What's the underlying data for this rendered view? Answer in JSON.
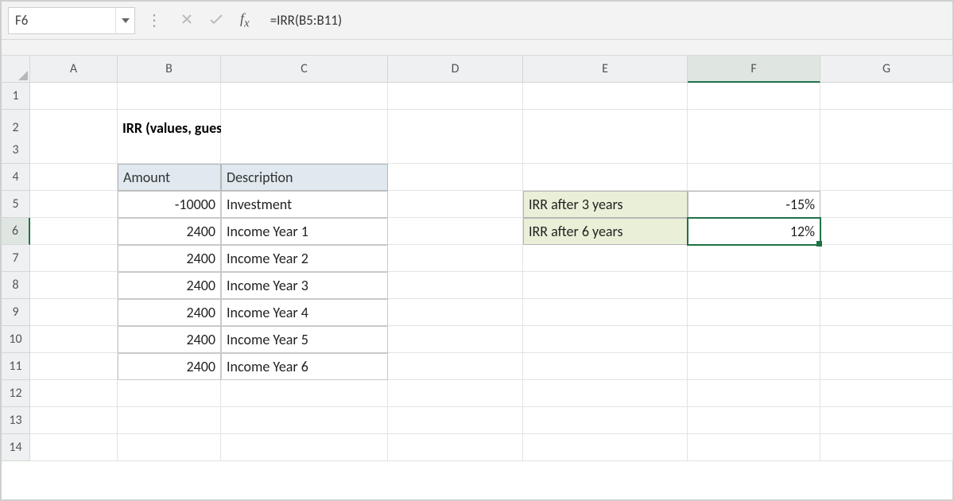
{
  "formula_bar": {
    "cell_ref": "F6",
    "formula": "=IRR(B5:B11)"
  },
  "columns": [
    "A",
    "B",
    "C",
    "D",
    "E",
    "F",
    "G"
  ],
  "rows": [
    "1",
    "2",
    "3",
    "4",
    "5",
    "6",
    "7",
    "8",
    "9",
    "10",
    "11",
    "12",
    "13",
    "14"
  ],
  "title": "IRR (values, guess)",
  "table": {
    "head_amount": "Amount",
    "head_desc": "Description",
    "rows": [
      {
        "amount": "-10000",
        "desc": "Investment"
      },
      {
        "amount": "2400",
        "desc": "Income Year 1"
      },
      {
        "amount": "2400",
        "desc": "Income Year 2"
      },
      {
        "amount": "2400",
        "desc": "Income Year 3"
      },
      {
        "amount": "2400",
        "desc": "Income Year 4"
      },
      {
        "amount": "2400",
        "desc": "Income Year 5"
      },
      {
        "amount": "2400",
        "desc": "Income Year 6"
      }
    ]
  },
  "results": {
    "r1_label": "IRR after 3 years",
    "r1_value": "-15%",
    "r2_label": "IRR after 6 years",
    "r2_value": "12%"
  }
}
